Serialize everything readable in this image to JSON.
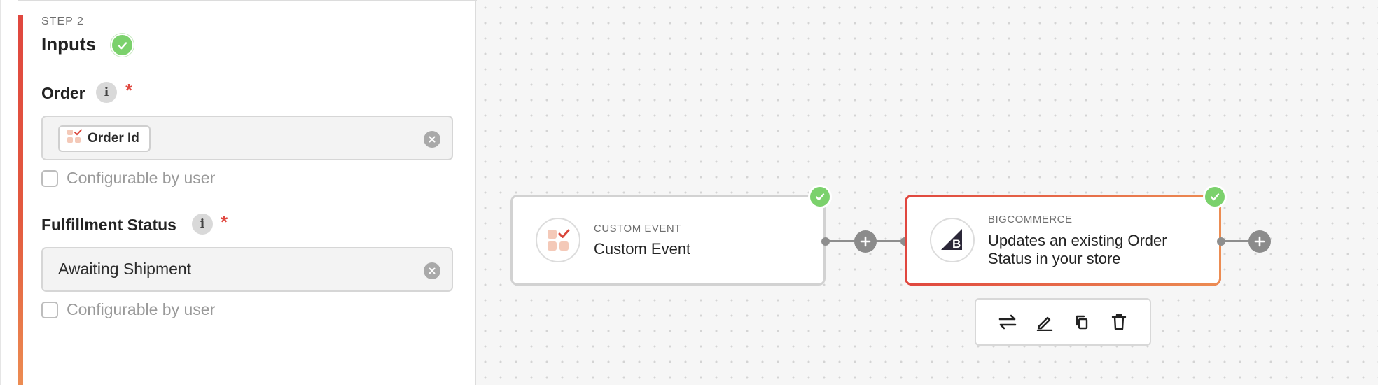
{
  "panel": {
    "step_label": "STEP 2",
    "section_title": "Inputs",
    "fields": [
      {
        "label": "Order",
        "required": "*",
        "chip_label": "Order Id",
        "configurable_label": "Configurable by user"
      },
      {
        "label": "Fulfillment Status",
        "required": "*",
        "value": "Awaiting Shipment",
        "configurable_label": "Configurable by user"
      }
    ]
  },
  "flow": {
    "nodes": [
      {
        "kicker": "CUSTOM EVENT",
        "title": "Custom Event",
        "icon": "custom-event-icon",
        "status": "complete"
      },
      {
        "kicker": "BIGCOMMERCE",
        "title_line1": "Updates an existing Order",
        "title_line2": "Status in your store",
        "icon": "bigcommerce-logo-icon",
        "status": "complete",
        "selected": true
      }
    ],
    "toolbar": [
      "swap-icon",
      "edit-icon",
      "duplicate-icon",
      "delete-icon"
    ]
  },
  "colors": {
    "accent_red": "#e0473f",
    "accent_orange": "#ec8c52",
    "success_green": "#7bd16c"
  }
}
